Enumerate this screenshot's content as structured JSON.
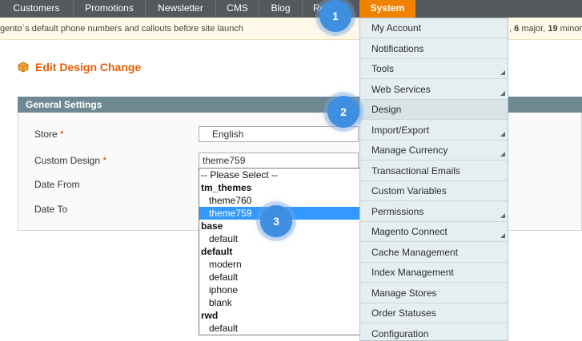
{
  "nav": {
    "items": [
      "Customers",
      "Promotions",
      "Newsletter",
      "CMS",
      "Blog",
      "Re"
    ],
    "system_label": "System"
  },
  "notice": {
    "text": "gento`s default phone numbers and callouts before site launch",
    "severity_major_count": "6",
    "severity_major_label": "major,",
    "severity_minor_count": "19",
    "severity_minor_label": "minor a"
  },
  "page": {
    "title": "Edit Design Change"
  },
  "fieldset": {
    "title": "General Settings",
    "store_label": "Store",
    "store_value": "English",
    "custom_design_label": "Custom Design",
    "custom_design_value": "theme759",
    "date_from_label": "Date From",
    "date_to_label": "Date To",
    "required_mark": "*"
  },
  "dropdown": {
    "options": [
      {
        "label": "-- Please Select --",
        "kind": "plain"
      },
      {
        "label": "tm_themes",
        "kind": "group"
      },
      {
        "label": "theme760",
        "kind": "child"
      },
      {
        "label": "theme759",
        "kind": "child",
        "selected": true
      },
      {
        "label": "base",
        "kind": "group"
      },
      {
        "label": "default",
        "kind": "child"
      },
      {
        "label": "default",
        "kind": "group"
      },
      {
        "label": "modern",
        "kind": "child"
      },
      {
        "label": "default",
        "kind": "child"
      },
      {
        "label": "iphone",
        "kind": "child"
      },
      {
        "label": "blank",
        "kind": "child"
      },
      {
        "label": "rwd",
        "kind": "group"
      },
      {
        "label": "default",
        "kind": "child"
      }
    ]
  },
  "system_menu": {
    "items": [
      {
        "label": "My Account",
        "submenu": false
      },
      {
        "label": "Notifications",
        "submenu": false
      },
      {
        "label": "Tools",
        "submenu": true
      },
      {
        "label": "Web Services",
        "submenu": true
      },
      {
        "label": "Design",
        "submenu": false
      },
      {
        "label": "Import/Export",
        "submenu": true
      },
      {
        "label": "Manage Currency",
        "submenu": true
      },
      {
        "label": "Transactional Emails",
        "submenu": false
      },
      {
        "label": "Custom Variables",
        "submenu": false
      },
      {
        "label": "Permissions",
        "submenu": true
      },
      {
        "label": "Magento Connect",
        "submenu": true
      },
      {
        "label": "Cache Management",
        "submenu": false
      },
      {
        "label": "Index Management",
        "submenu": false
      },
      {
        "label": "Manage Stores",
        "submenu": false
      },
      {
        "label": "Order Statuses",
        "submenu": false
      },
      {
        "label": "Configuration",
        "submenu": false
      }
    ]
  },
  "callouts": [
    "1",
    "2",
    "3"
  ],
  "colors": {
    "accent": "#f18200",
    "heading": "#eb5e00",
    "fieldset_header": "#6f8992",
    "selection": "#3399ff",
    "callout": "#3f8fe0"
  }
}
